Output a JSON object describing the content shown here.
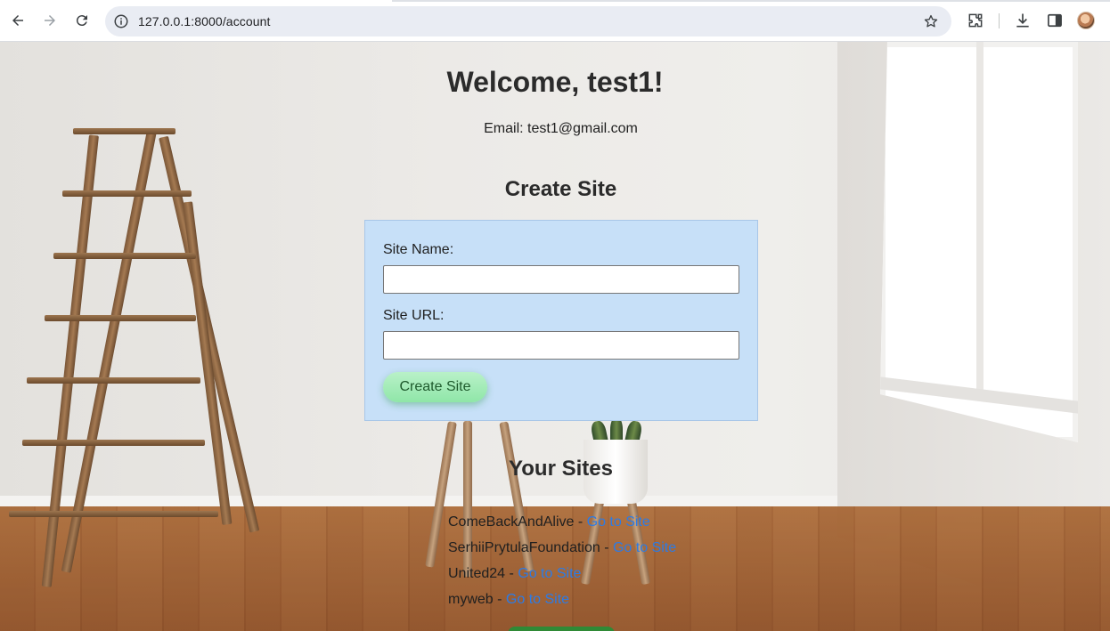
{
  "browser": {
    "url": "127.0.0.1:8000/account"
  },
  "page": {
    "welcome": "Welcome, test1!",
    "email_label": "Email:",
    "email_value": "test1@gmail.com",
    "create_heading": "Create Site",
    "form": {
      "site_name_label": "Site Name:",
      "site_name_value": "",
      "site_url_label": "Site URL:",
      "site_url_value": "",
      "submit_label": "Create Site"
    },
    "sites_heading": "Your Sites",
    "separator": " - ",
    "sites": [
      {
        "name": "ComeBackAndAlive",
        "link": "Go to Site"
      },
      {
        "name": "SerhiiPrytulaFoundation",
        "link": "Go to Site"
      },
      {
        "name": "United24",
        "link": "Go to Site"
      },
      {
        "name": "myweb",
        "link": "Go to Site"
      }
    ]
  },
  "colors": {
    "form_bg": "#c7e0f8",
    "button_bg": "#a6ecba",
    "link": "#2c7be5"
  }
}
